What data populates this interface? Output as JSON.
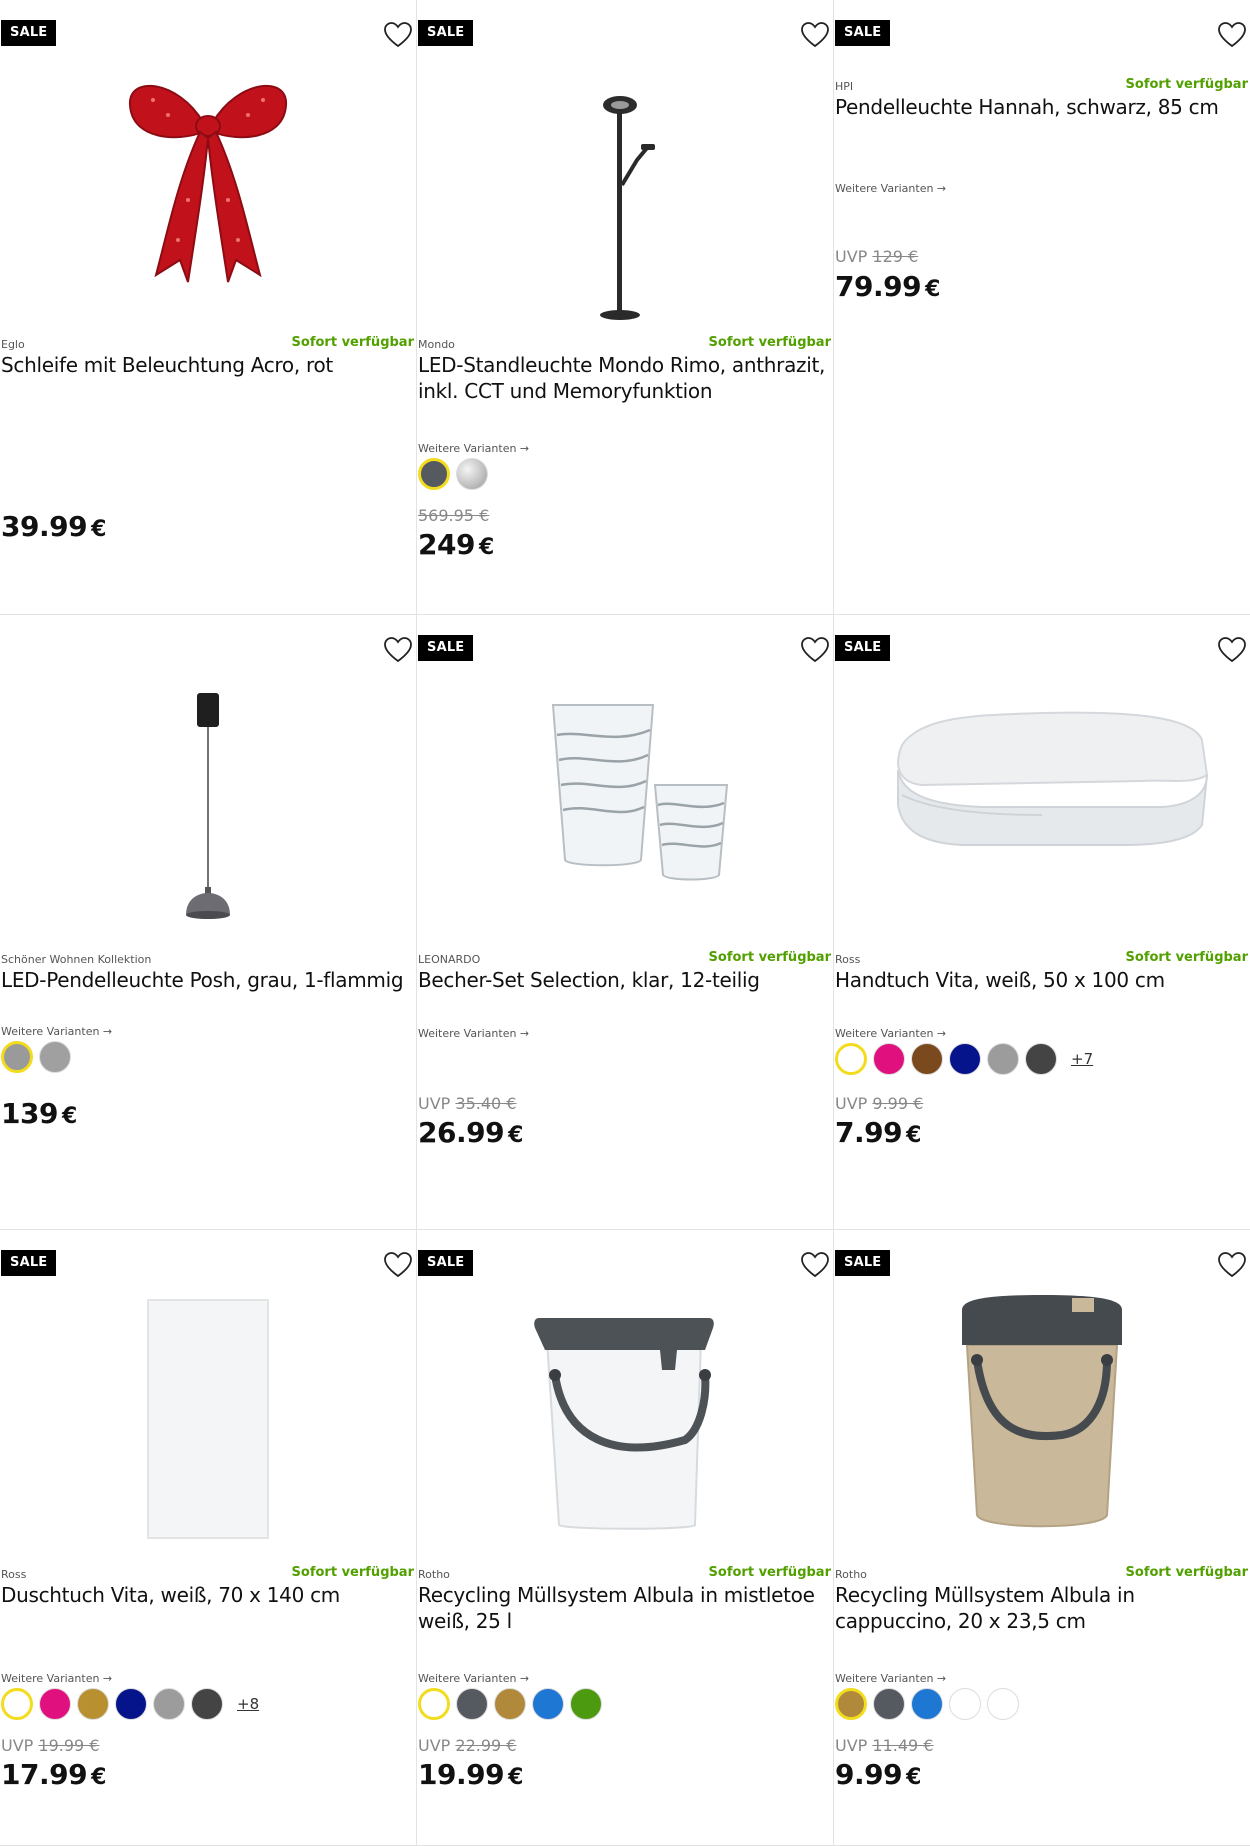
{
  "labels": {
    "sale": "SALE",
    "availability": "Sofort verfügbar",
    "variants": "Weitere Varianten →",
    "uvp_prefix": "UVP"
  },
  "products": [
    {
      "brand": "Eglo",
      "title": "Schleife mit Beleuchtung Acro, rot",
      "sale": true,
      "available": true,
      "variants": false,
      "old_price": "",
      "uvp": false,
      "price": "39.99",
      "currency": "€",
      "image": "red-bow-image"
    },
    {
      "brand": "Mondo",
      "title": "LED-Standleuchte Mondo Rimo, anthrazit, inkl. CCT und Memoryfunktion",
      "sale": true,
      "available": true,
      "variants": true,
      "swatches": [
        "#555a60",
        "#d0d0d0"
      ],
      "more": "",
      "old_price": "569.95 €",
      "uvp": false,
      "price": "249",
      "currency": "€",
      "image": "floor-lamp-image"
    },
    {
      "brand": "HPI",
      "title": "Pendelleuchte Hannah, schwarz, 85 cm",
      "sale": true,
      "available": true,
      "variants": true,
      "swatches": [],
      "more": "",
      "old_price": "129 €",
      "uvp": true,
      "price": "79.99",
      "currency": "€",
      "image": ""
    },
    {
      "brand": "Schöner Wohnen Kollektion",
      "title": "LED-Pendelleuchte Posh, grau, 1-flammig",
      "sale": false,
      "available": false,
      "variants": true,
      "swatches": [
        "#9a9a9a",
        "#a0a0a0"
      ],
      "more": "",
      "old_price": "",
      "uvp": false,
      "price": "139",
      "currency": "€",
      "image": "pendant-lamp-image"
    },
    {
      "brand": "LEONARDO",
      "title": "Becher-Set Selection, klar, 12-teilig",
      "sale": true,
      "available": true,
      "variants": true,
      "swatches": [],
      "more": "",
      "old_price": "35.40 €",
      "uvp": true,
      "price": "26.99",
      "currency": "€",
      "image": "glasses-image"
    },
    {
      "brand": "Ross",
      "title": "Handtuch Vita, weiß, 50 x 100 cm",
      "sale": true,
      "available": true,
      "variants": true,
      "swatches": [
        "#ffffff",
        "#e0117f",
        "#7a4a1e",
        "#06148c",
        "#9c9c9c",
        "#444444"
      ],
      "more": "+7",
      "old_price": "9.99 €",
      "uvp": true,
      "price": "7.99",
      "currency": "€",
      "image": "towel-image"
    },
    {
      "brand": "Ross",
      "title": "Duschtuch Vita, weiß, 70 x 140 cm",
      "sale": true,
      "available": true,
      "variants": true,
      "swatches": [
        "#ffffff",
        "#e0117f",
        "#b8902f",
        "#06148c",
        "#9c9c9c",
        "#444444"
      ],
      "more": "+8",
      "old_price": "19.99 €",
      "uvp": true,
      "price": "17.99",
      "currency": "€",
      "image": "bath-sheet-image"
    },
    {
      "brand": "Rotho",
      "title": "Recycling Müllsystem Albula in mistletoe weiß, 25 l",
      "sale": true,
      "available": true,
      "variants": true,
      "swatches": [
        "#ffffff",
        "#555a60",
        "#b08a3a",
        "#1f77d4",
        "#4c9a10"
      ],
      "more": "",
      "old_price": "22.99 €",
      "uvp": true,
      "price": "19.99",
      "currency": "€",
      "image": "white-bin-image"
    },
    {
      "brand": "Rotho",
      "title": "Recycling Müllsystem Albula in cappuccino, 20 x 23,5 cm",
      "sale": true,
      "available": true,
      "variants": true,
      "swatches": [
        "#b08a3a",
        "#555a60",
        "#1f77d4",
        "#ffffff",
        "#ffffff"
      ],
      "more": "",
      "old_price": "11.49 €",
      "uvp": true,
      "price": "9.99",
      "currency": "€",
      "image": "cappuccino-bin-image"
    }
  ]
}
